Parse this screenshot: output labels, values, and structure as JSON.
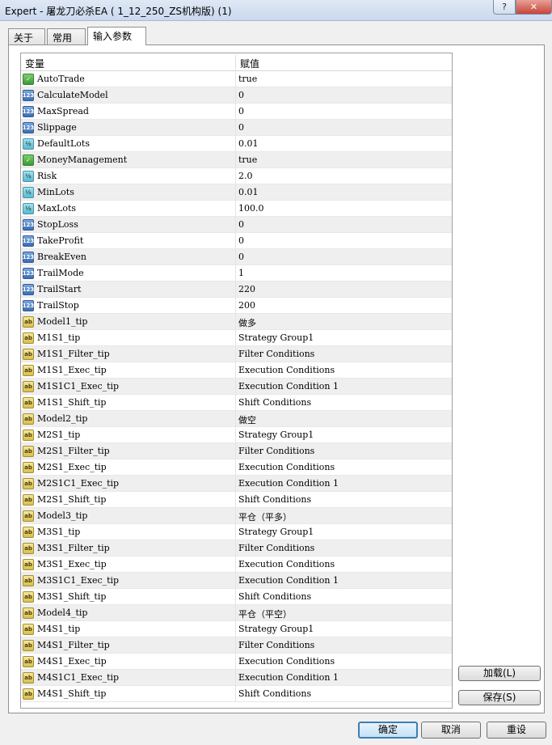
{
  "window": {
    "title": "Expert - 屠龙刀必杀EA ( 1_12_250_ZS机构版) (1)",
    "help_label": "?",
    "close_label": "✕"
  },
  "tabs": [
    {
      "label": "关于"
    },
    {
      "label": "常用"
    },
    {
      "label": "输入参数",
      "active": true
    }
  ],
  "grid": {
    "header": {
      "variable": "变量",
      "value": "赋值"
    },
    "rows": [
      {
        "name": "AutoTrade",
        "value": "true",
        "type": "bool"
      },
      {
        "name": "CalculateModel",
        "value": "0",
        "type": "int"
      },
      {
        "name": "MaxSpread",
        "value": "0",
        "type": "int"
      },
      {
        "name": "Slippage",
        "value": "0",
        "type": "int"
      },
      {
        "name": "DefaultLots",
        "value": "0.01",
        "type": "double"
      },
      {
        "name": "MoneyManagement",
        "value": "true",
        "type": "bool"
      },
      {
        "name": "Risk",
        "value": "2.0",
        "type": "double"
      },
      {
        "name": "MinLots",
        "value": "0.01",
        "type": "double"
      },
      {
        "name": "MaxLots",
        "value": "100.0",
        "type": "double"
      },
      {
        "name": "StopLoss",
        "value": "0",
        "type": "int"
      },
      {
        "name": "TakeProfit",
        "value": "0",
        "type": "int"
      },
      {
        "name": "BreakEven",
        "value": "0",
        "type": "int"
      },
      {
        "name": "TrailMode",
        "value": "1",
        "type": "int"
      },
      {
        "name": "TrailStart",
        "value": "220",
        "type": "int"
      },
      {
        "name": "TrailStop",
        "value": "200",
        "type": "int"
      },
      {
        "name": "Model1_tip",
        "value": "做多",
        "type": "string"
      },
      {
        "name": "M1S1_tip",
        "value": "Strategy Group1",
        "type": "string"
      },
      {
        "name": "M1S1_Filter_tip",
        "value": "Filter Conditions",
        "type": "string"
      },
      {
        "name": "M1S1_Exec_tip",
        "value": "Execution Conditions",
        "type": "string"
      },
      {
        "name": "M1S1C1_Exec_tip",
        "value": "Execution Condition 1",
        "type": "string"
      },
      {
        "name": "M1S1_Shift_tip",
        "value": "Shift Conditions",
        "type": "string"
      },
      {
        "name": "Model2_tip",
        "value": "做空",
        "type": "string"
      },
      {
        "name": "M2S1_tip",
        "value": "Strategy Group1",
        "type": "string"
      },
      {
        "name": "M2S1_Filter_tip",
        "value": "Filter Conditions",
        "type": "string"
      },
      {
        "name": "M2S1_Exec_tip",
        "value": "Execution Conditions",
        "type": "string"
      },
      {
        "name": "M2S1C1_Exec_tip",
        "value": "Execution Condition 1",
        "type": "string"
      },
      {
        "name": "M2S1_Shift_tip",
        "value": "Shift Conditions",
        "type": "string"
      },
      {
        "name": "Model3_tip",
        "value": "平仓（平多）",
        "type": "string"
      },
      {
        "name": "M3S1_tip",
        "value": "Strategy Group1",
        "type": "string"
      },
      {
        "name": "M3S1_Filter_tip",
        "value": "Filter Conditions",
        "type": "string"
      },
      {
        "name": "M3S1_Exec_tip",
        "value": "Execution Conditions",
        "type": "string"
      },
      {
        "name": "M3S1C1_Exec_tip",
        "value": "Execution Condition 1",
        "type": "string"
      },
      {
        "name": "M3S1_Shift_tip",
        "value": "Shift Conditions",
        "type": "string"
      },
      {
        "name": "Model4_tip",
        "value": "平仓（平空）",
        "type": "string"
      },
      {
        "name": "M4S1_tip",
        "value": "Strategy Group1",
        "type": "string"
      },
      {
        "name": "M4S1_Filter_tip",
        "value": "Filter Conditions",
        "type": "string"
      },
      {
        "name": "M4S1_Exec_tip",
        "value": "Execution Conditions",
        "type": "string"
      },
      {
        "name": "M4S1C1_Exec_tip",
        "value": "Execution Condition 1",
        "type": "string"
      },
      {
        "name": "M4S1_Shift_tip",
        "value": "Shift Conditions",
        "type": "string"
      }
    ]
  },
  "type_icons": {
    "bool": {
      "glyph": "✓",
      "icon": "boolean-type-icon"
    },
    "int": {
      "glyph": "123",
      "icon": "integer-type-icon"
    },
    "double": {
      "glyph": "½",
      "icon": "double-type-icon"
    },
    "string": {
      "glyph": "ab",
      "icon": "string-type-icon"
    }
  },
  "side_buttons": {
    "load_label": "加载(L)",
    "save_label": "保存(S)"
  },
  "footer": {
    "ok_label": "确定",
    "cancel_label": "取消",
    "reset_label": "重设"
  }
}
